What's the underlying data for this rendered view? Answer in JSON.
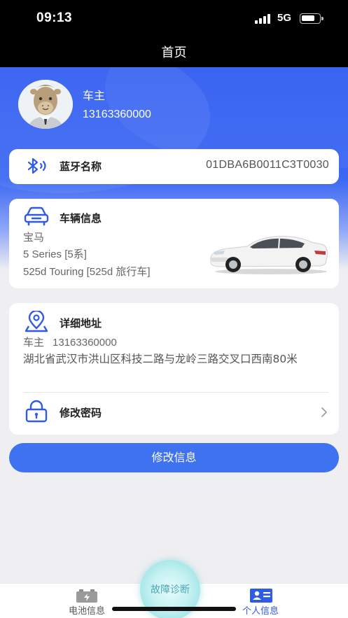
{
  "status_bar": {
    "time": "09:13",
    "network": "5G"
  },
  "nav": {
    "title": "首页"
  },
  "user": {
    "name": "车主",
    "phone": "13163360000"
  },
  "bluetooth": {
    "label": "蓝牙名称",
    "value": "01DBA6B0011C3T0030"
  },
  "vehicle": {
    "label": "车辆信息",
    "brand": "宝马",
    "series": "5 Series [5系]",
    "model": "525d Touring [525d 旅行车]"
  },
  "address": {
    "label": "详细地址",
    "owner_name": "车主",
    "owner_phone": "13163360000",
    "detail": "湖北省武汉市洪山区科技二路与龙岭三路交叉口西南80米"
  },
  "password": {
    "label": "修改密码"
  },
  "edit_button": {
    "label": "修改信息"
  },
  "tabs": {
    "battery": "电池信息",
    "diagnosis": "故障诊断",
    "profile": "个人信息",
    "active": "profile"
  },
  "colors": {
    "primary": "#3e72f0",
    "header_blue": "#2f5cf2",
    "active_tab": "#2f5be8",
    "diagnosis_teal": "#4aa9b3"
  },
  "icons": [
    "bluetooth-icon",
    "car-icon",
    "location-pin-icon",
    "lock-icon",
    "chevron-right-icon",
    "battery-tab-icon",
    "id-card-tab-icon"
  ]
}
